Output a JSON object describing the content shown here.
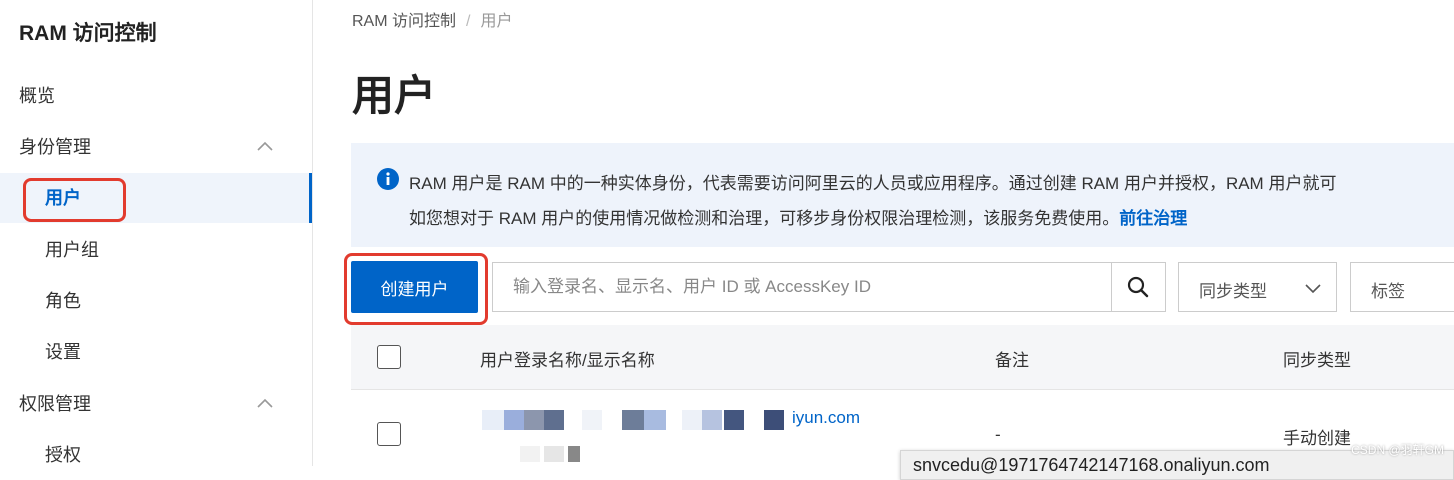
{
  "sidebar": {
    "title": "RAM 访问控制",
    "items": [
      {
        "label": "概览",
        "sub": false,
        "chevron": false,
        "active": false
      },
      {
        "label": "身份管理",
        "sub": false,
        "chevron": true,
        "active": false
      },
      {
        "label": "用户",
        "sub": true,
        "chevron": false,
        "active": true
      },
      {
        "label": "用户组",
        "sub": true,
        "chevron": false,
        "active": false
      },
      {
        "label": "角色",
        "sub": true,
        "chevron": false,
        "active": false
      },
      {
        "label": "设置",
        "sub": true,
        "chevron": false,
        "active": false
      },
      {
        "label": "权限管理",
        "sub": false,
        "chevron": true,
        "active": false
      },
      {
        "label": "授权",
        "sub": true,
        "chevron": false,
        "active": false
      }
    ]
  },
  "breadcrumb": {
    "root": "RAM 访问控制",
    "separator": "/",
    "current": "用户"
  },
  "page_title": "用户",
  "notice": {
    "icon": "info-icon",
    "line1": "RAM 用户是 RAM 中的一种实体身份，代表需要访问阿里云的人员或应用程序。通过创建 RAM 用户并授权，RAM 用户就可",
    "line2": "如您想对于 RAM 用户的使用情况做检测和治理，可移步身份权限治理检测，该服务免费使用。",
    "link": "前往治理"
  },
  "toolbar": {
    "create_button": "创建用户",
    "search_placeholder": "输入登录名、显示名、用户 ID 或 AccessKey ID",
    "sync_type_select": "同步类型",
    "tag_select": "标签"
  },
  "table": {
    "columns": [
      "用户登录名称/显示名称",
      "备注",
      "同步类型"
    ],
    "rows": [
      {
        "login_suffix": "iyun.com",
        "note": "-",
        "sync_type": "手动创建"
      }
    ]
  },
  "tooltip": "snvcedu@1971764742147168.onaliyun.com",
  "watermark": "CSDN @羽轩GM",
  "colors": {
    "accent": "#0064c8",
    "highlight_box": "#e23b2e",
    "notice_bg": "#eef3fb"
  }
}
